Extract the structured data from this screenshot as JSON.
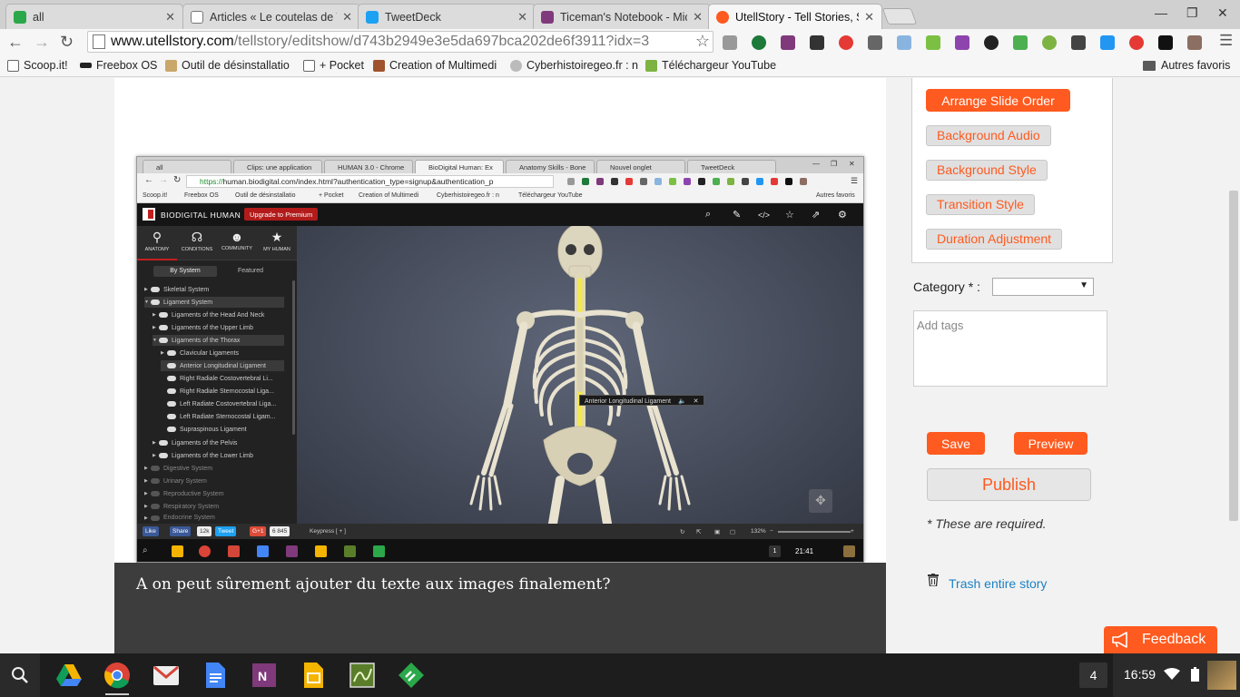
{
  "browser": {
    "tabs": [
      {
        "title": "all",
        "favicon_color": "#2aa84a"
      },
      {
        "title": "Articles « Le coutelas de Ti",
        "favicon_color": "#ffffff"
      },
      {
        "title": "TweetDeck",
        "favicon_color": "#1da1f2"
      },
      {
        "title": "Ticeman's Notebook - Mic",
        "favicon_color": "#80397b"
      },
      {
        "title": "UtellStory - Tell Stories, Sh",
        "favicon_color": "#ff5a1f"
      }
    ],
    "url_host": "www.utellstory.com",
    "url_path": "/tellstory/editshow/d743b2949e3e5da697bca202de6f3911?idx=3",
    "bookmarks": [
      {
        "label": "Scoop.it!"
      },
      {
        "label": "Freebox OS"
      },
      {
        "label": "Outil de désinstallatio"
      },
      {
        "label": "+ Pocket"
      },
      {
        "label": "Creation of Multimedi"
      },
      {
        "label": "Cyberhistoiregeo.fr : n"
      },
      {
        "label": "Téléchargeur YouTube"
      }
    ],
    "other_bookmarks": "Autres favoris"
  },
  "slide": {
    "caption": "A on peut sûrement ajouter du texte aux images finalement?",
    "screenshot": {
      "tabs": [
        "all",
        "Clips: une application",
        "HUMAN 3.0 - Chrome",
        "BioDigital Human: Ex",
        "Anatomy Skills - Bone",
        "Nouvel onglet",
        "TweetDeck"
      ],
      "url_secure": "https://",
      "url_rest": "human.biodigital.com/index.html?authentication_type=signup&authentication_p",
      "bookmarks": [
        "Scoop.it!",
        "Freebox OS",
        "Outil de désinstallatio",
        "+ Pocket",
        "Creation of Multimedi",
        "Cyberhistoiregeo.fr : n",
        "Téléchargeur YouTube"
      ],
      "other_bookmarks": "Autres favoris",
      "brand": "BIODIGITAL HUMAN",
      "upgrade_label": "Upgrade to Premium",
      "nav": [
        "ANATOMY",
        "CONDITIONS",
        "COMMUNITY",
        "MY HUMAN"
      ],
      "subtabs": [
        "By System",
        "Featured"
      ],
      "tree": [
        {
          "label": "Skeletal System"
        },
        {
          "label": "Ligament System"
        },
        {
          "label": "Ligaments of the Head And Neck"
        },
        {
          "label": "Ligaments of the Upper Limb"
        },
        {
          "label": "Ligaments of the Thorax"
        },
        {
          "label": "Clavicular Ligaments"
        },
        {
          "label": "Anterior Longitudinal Ligament"
        },
        {
          "label": "Right Radiale Costovertebral Li..."
        },
        {
          "label": "Right Radiale Sternocostal Liga..."
        },
        {
          "label": "Left Radiate Costovertebral Liga..."
        },
        {
          "label": "Left Radiate Sternocostal Ligam..."
        },
        {
          "label": "Supraspinous Ligament"
        },
        {
          "label": "Ligaments of the Pelvis"
        },
        {
          "label": "Ligaments of the Lower Limb"
        },
        {
          "label": "Digestive System"
        },
        {
          "label": "Urinary System"
        },
        {
          "label": "Reproductive System"
        },
        {
          "label": "Respiratory System"
        },
        {
          "label": "Endocrine System"
        }
      ],
      "tooltip": "Anterior Longitudinal Ligament",
      "social": [
        "Like",
        "Share",
        "12k",
        "Tweet",
        "G+1",
        "6 845"
      ],
      "keypress": "Keypress [ + ]",
      "zoom": "132%",
      "shelf_badge": "1",
      "clock": "21:41"
    }
  },
  "panel": {
    "arrange_label": "Arrange Slide Order",
    "options": [
      "Background Audio",
      "Background Style",
      "Transition Style",
      "Duration Adjustment"
    ],
    "category_label": "Category * :",
    "tags_placeholder": "Add tags",
    "save_label": "Save",
    "preview_label": "Preview",
    "publish_label": "Publish",
    "required_note": "* These are required.",
    "trash_label": "Trash entire story",
    "feedback_label": "Feedback"
  },
  "os": {
    "badge": "4",
    "clock": "16:59"
  },
  "colors": {
    "accent": "#ff5a1f",
    "link": "#1c82c4",
    "shelf": "#1d1d1d"
  }
}
